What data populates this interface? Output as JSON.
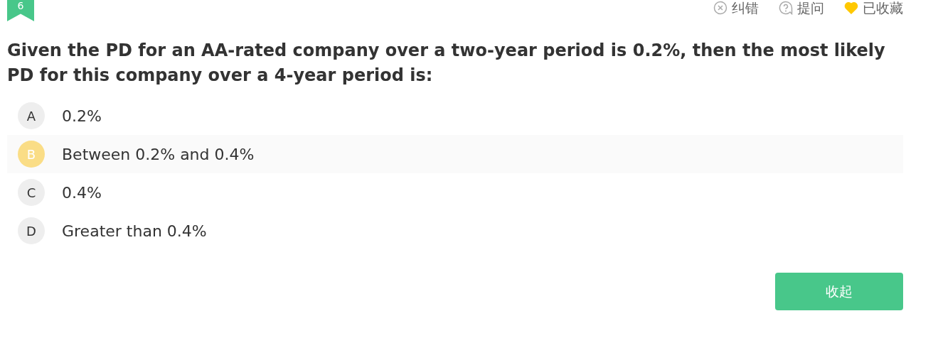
{
  "question_number": "6",
  "actions": [
    {
      "kind": "report",
      "label": "纠错"
    },
    {
      "kind": "ask",
      "label": "提问"
    },
    {
      "kind": "favorite",
      "label": "已收藏",
      "on": true
    }
  ],
  "question": "Given the PD for an AA-rated company over a two-year period is 0.2%, then the most likely PD for this company over a 4-year period is:",
  "options": [
    {
      "letter": "A",
      "text": "0.2%",
      "selected": false
    },
    {
      "letter": "B",
      "text": "Between 0.2% and 0.4%",
      "selected": true
    },
    {
      "letter": "C",
      "text": "0.4%",
      "selected": false
    },
    {
      "letter": "D",
      "text": "Greater than 0.4%",
      "selected": false
    }
  ],
  "collapse_button": "收起"
}
